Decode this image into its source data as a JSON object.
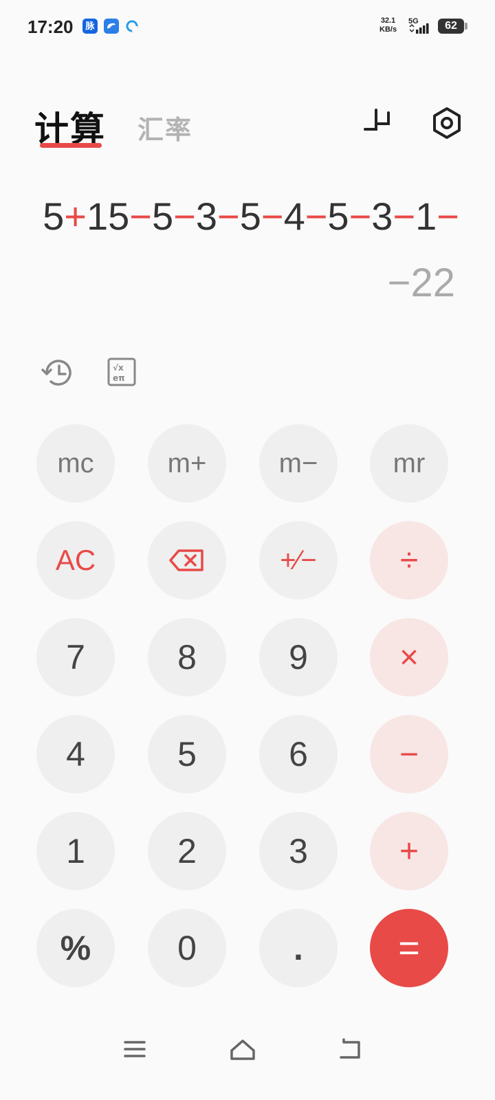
{
  "status_bar": {
    "time": "17:20",
    "notif_1": "脉",
    "netspeed_value": "32.1",
    "netspeed_unit": "KB/s",
    "network": "5G",
    "battery": "62"
  },
  "header": {
    "tab_calculate": "计算",
    "tab_exchange": "汇率"
  },
  "display": {
    "expression": [
      {
        "t": "5",
        "op": false
      },
      {
        "t": "+",
        "op": true
      },
      {
        "t": "15",
        "op": false
      },
      {
        "t": "−",
        "op": true
      },
      {
        "t": "5",
        "op": false
      },
      {
        "t": "−",
        "op": true
      },
      {
        "t": "3",
        "op": false
      },
      {
        "t": "−",
        "op": true
      },
      {
        "t": "5",
        "op": false
      },
      {
        "t": "−",
        "op": true
      },
      {
        "t": "4",
        "op": false
      },
      {
        "t": "−",
        "op": true
      },
      {
        "t": "5",
        "op": false
      },
      {
        "t": "−",
        "op": true
      },
      {
        "t": "3",
        "op": false
      },
      {
        "t": "−",
        "op": true
      },
      {
        "t": "1",
        "op": false
      },
      {
        "t": "−",
        "op": true
      }
    ],
    "result": "−22"
  },
  "keypad": {
    "mc": "mc",
    "m_plus": "m+",
    "m_minus": "m−",
    "mr": "mr",
    "ac": "AC",
    "plus_minus": "+∕−",
    "divide": "÷",
    "seven": "7",
    "eight": "8",
    "nine": "9",
    "multiply": "×",
    "four": "4",
    "five": "5",
    "six": "6",
    "minus": "−",
    "one": "1",
    "two": "2",
    "three": "3",
    "plus": "+",
    "percent": "%",
    "zero": "0",
    "dot": ".",
    "equals": "="
  },
  "colors": {
    "accent": "#e84a47",
    "operator_key_bg": "#f8e6e5",
    "key_bg": "#efefef",
    "background": "#fafafa"
  }
}
